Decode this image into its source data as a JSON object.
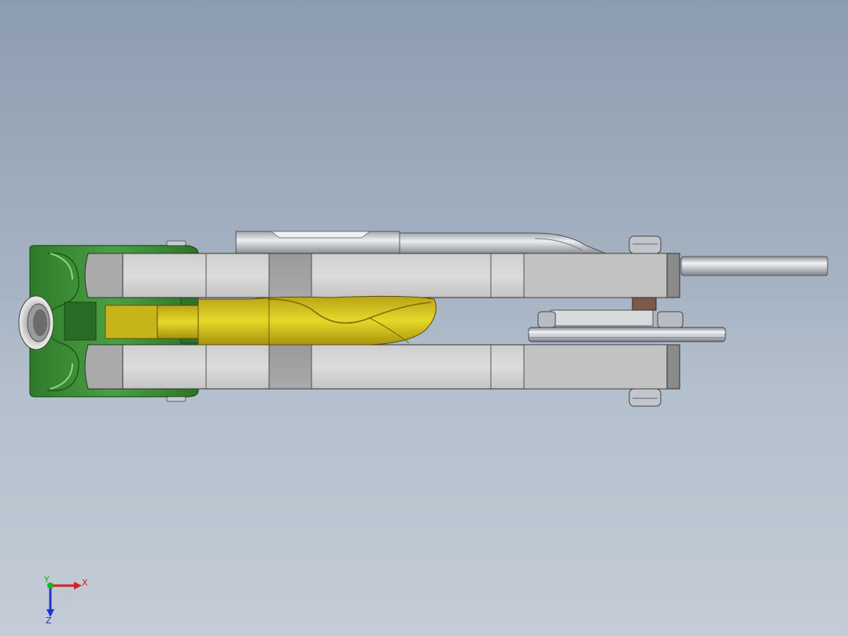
{
  "viewport": {
    "background_top": "#8d9db0",
    "background_bottom": "#c4ccd6"
  },
  "model": {
    "parts": [
      {
        "name": "green-housing",
        "color": "#3f8f3a"
      },
      {
        "name": "yellow-cam-lever",
        "color": "#d6c21c"
      },
      {
        "name": "gray-side-plates",
        "color": "#d8d8d8"
      },
      {
        "name": "steel-rod",
        "color": "#c9cbd0"
      },
      {
        "name": "pulley-wheel",
        "color": "#b8bcc4"
      }
    ]
  },
  "triad": {
    "x_label": "X",
    "y_label": "Y",
    "z_label": "Z",
    "x_color": "#d42020",
    "y_color": "#1fae2a",
    "z_color": "#2233cc"
  }
}
